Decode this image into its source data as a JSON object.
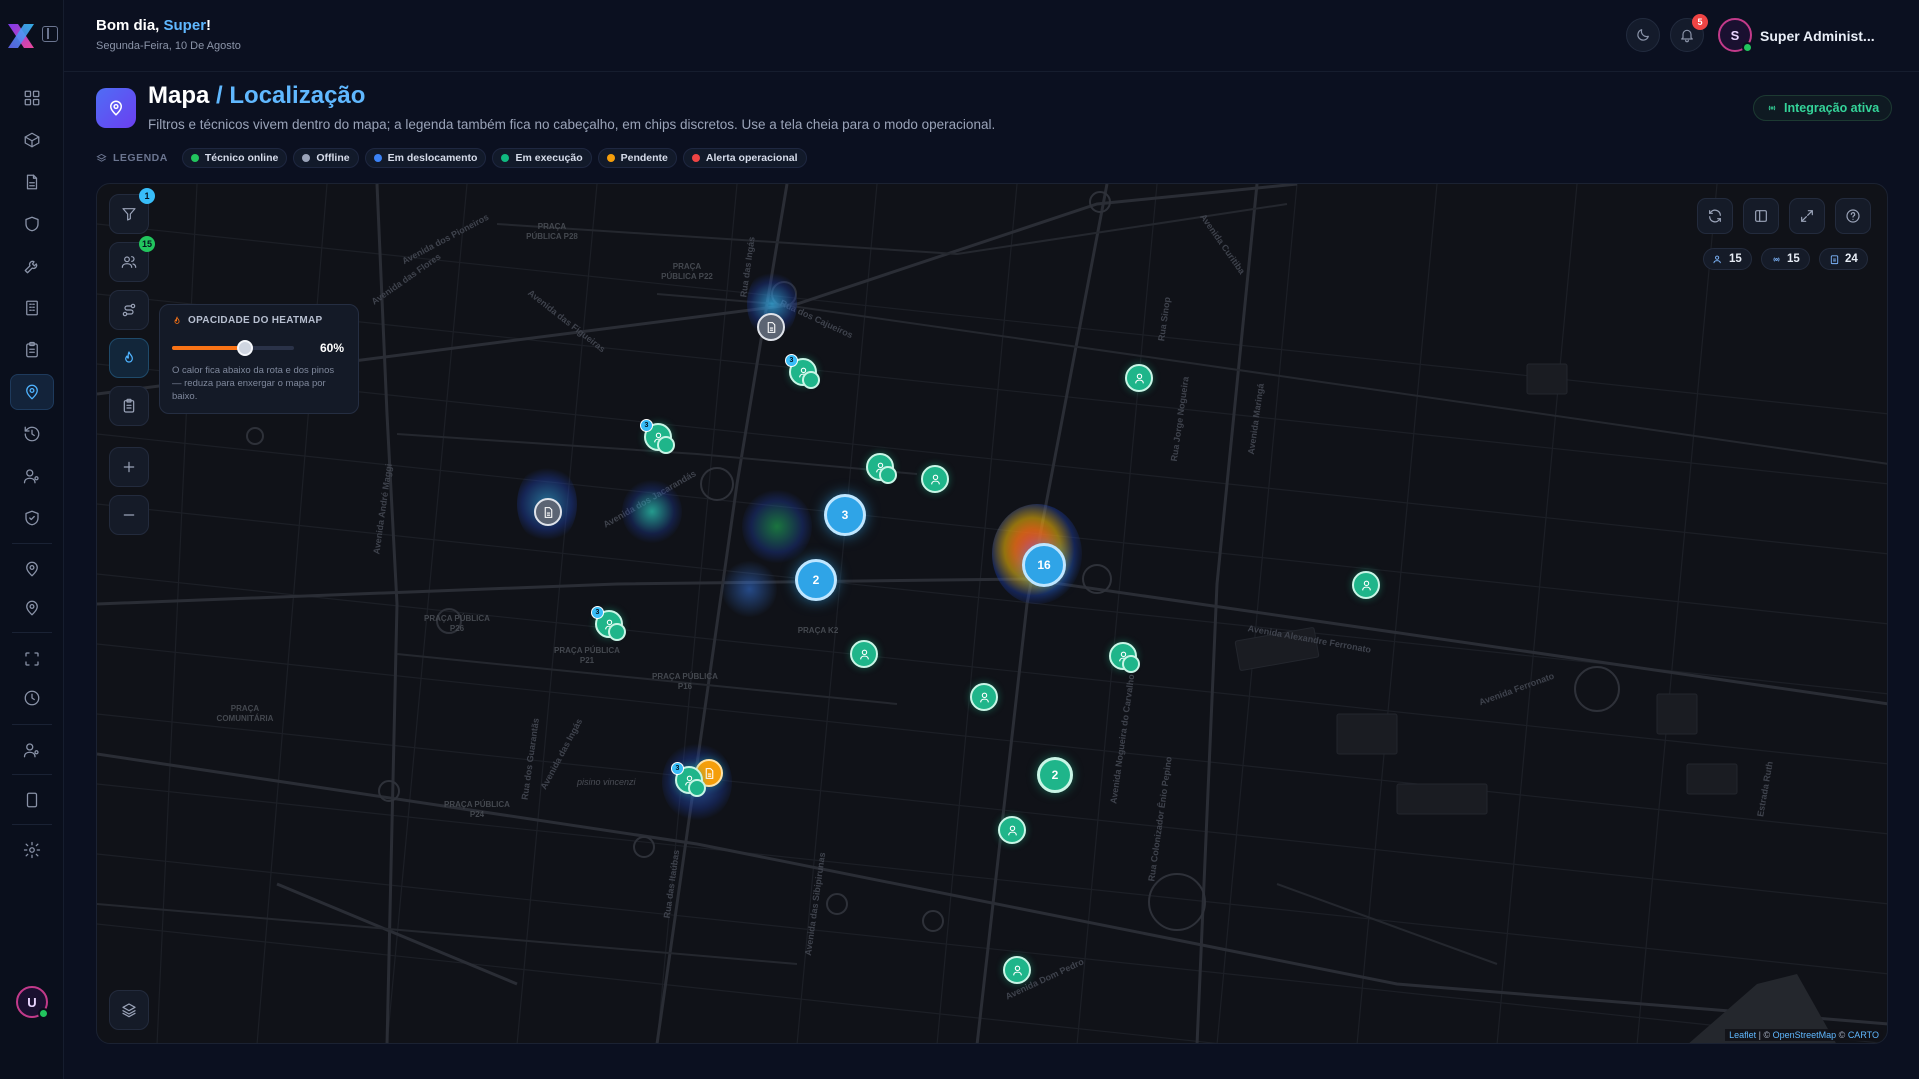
{
  "header": {
    "greeting": "Bom dia, ",
    "user_first_name": "Super",
    "greeting_end": "!",
    "date": "Segunda-Feira, 10 De Agosto",
    "notifications_count": "5",
    "avatar_initial": "S",
    "user_name": "Super Administ..."
  },
  "page": {
    "title": "Mapa",
    "breadcrumb": "/ Localização",
    "description": "Filtros e técnicos vivem dentro do mapa; a legenda também fica no cabeçalho, em chips discretos. Use a tela cheia para o modo operacional.",
    "integration_status": "Integração ativa"
  },
  "legend": {
    "title": "LEGENDA",
    "items": [
      {
        "label": "Técnico online",
        "color": "#22c55e"
      },
      {
        "label": "Offline",
        "color": "#9aa3b8"
      },
      {
        "label": "Em deslocamento",
        "color": "#3b82f6"
      },
      {
        "label": "Em execução",
        "color": "#10b981"
      },
      {
        "label": "Pendente",
        "color": "#f59e0b"
      },
      {
        "label": "Alerta operacional",
        "color": "#ef4444"
      }
    ]
  },
  "map_tools": {
    "filter_badge": "1",
    "technicians_badge": "15"
  },
  "heatmap": {
    "title": "OPACIDADE DO HEATMAP",
    "opacity": 0.6,
    "value_label": "60%",
    "hint": "O calor fica abaixo da rota e dos pinos — reduza para enxergar o mapa por baixo."
  },
  "stats": {
    "technicians": "15",
    "online": "15",
    "orders": "24"
  },
  "clusters": {
    "c1": "3",
    "c2": "2",
    "c3": "16",
    "c4": "2"
  },
  "multi_tag": "3",
  "streets": {
    "s1": "Avenida dos Pioneiros",
    "s2": "Avenida das Flores",
    "s3": "Rua dos Cajueiros",
    "s4": "Avenida das Figueiras",
    "s5": "Rua das Ingás",
    "s6": "Avenida dos Jacarandás",
    "s7": "Avenida André Maggi",
    "s8": "Rua dos Guarantãs",
    "s9": "Avenida das Ingás",
    "s10": "Rua das Itaúbas",
    "s11": "Avenida das Sibipirunas",
    "s12": "Rua Colonizador Ênio Pepino",
    "s13": "Avenida Nogueira do Carvalho",
    "s14": "Avenida Alexandre Ferronato",
    "s15": "Avenida Maringá",
    "s16": "Estrada Ruth",
    "s17": "Avenida Dom Pedro",
    "s18": "Avenida Curitiba",
    "s19": "Avenida Ferronato",
    "s20": "Rua Sinop",
    "s21": "Rua Jorge Nogueira",
    "s22": "pisino vincenzi"
  },
  "plazas": {
    "p1": "PRAÇA PÚBLICA P28",
    "p2": "PRAÇA PÚBLICA P22",
    "p3": "PRAÇA PÚBLICA P26",
    "p4": "PRAÇA PÚBLICA P21",
    "p5": "PRAÇA PÚBLICA P16",
    "p6": "PRAÇA COMUNITÁRIA",
    "p7": "PRAÇA PÚBLICA P24",
    "p8": "PRAÇA K2"
  },
  "attribution": {
    "leaflet": "Leaflet",
    "sep": " | © ",
    "osm": "OpenStreetMap",
    "sep2": " © ",
    "carto": "CARTO"
  }
}
